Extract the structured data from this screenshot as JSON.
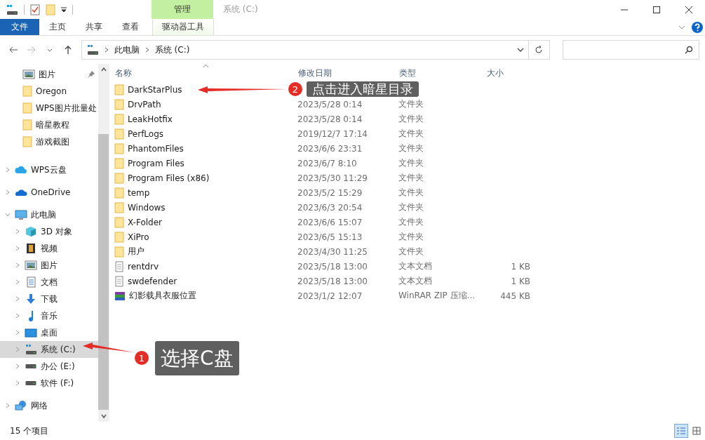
{
  "window": {
    "title": "系统 (C:)",
    "context_tab": "管理"
  },
  "ribbon_tabs": [
    {
      "label": "文件",
      "kind": "file",
      "selected": false
    },
    {
      "label": "主页",
      "kind": "tab",
      "selected": false
    },
    {
      "label": "共享",
      "kind": "tab",
      "selected": false
    },
    {
      "label": "查看",
      "kind": "tab",
      "selected": false
    },
    {
      "label": "驱动器工具",
      "kind": "context",
      "selected": false
    }
  ],
  "address": {
    "breadcrumb": [
      "此电脑",
      "系统 (C:)"
    ]
  },
  "quick_access": [
    {
      "label": "图片",
      "kind": "pictures",
      "pinned": true
    },
    {
      "label": "Oregon",
      "kind": "folder",
      "pinned": false
    },
    {
      "label": "WPS图片批量处",
      "kind": "folder",
      "pinned": false
    },
    {
      "label": "暗星教程",
      "kind": "folder",
      "pinned": false
    },
    {
      "label": "游戏截图",
      "kind": "folder",
      "pinned": false
    }
  ],
  "nav_tree": [
    {
      "label": "WPS云盘",
      "kind": "cloud",
      "expanded": false,
      "selected": false
    },
    {
      "label": "OneDrive",
      "kind": "onedrive",
      "expanded": false,
      "selected": false
    },
    {
      "label": "此电脑",
      "kind": "pc",
      "expanded": true,
      "selected": false,
      "children": [
        {
          "label": "3D 对象",
          "kind": "cube",
          "expanded": false,
          "selected": false
        },
        {
          "label": "视频",
          "kind": "video",
          "expanded": false,
          "selected": false
        },
        {
          "label": "图片",
          "kind": "pictures",
          "expanded": false,
          "selected": false
        },
        {
          "label": "文档",
          "kind": "document",
          "expanded": false,
          "selected": false
        },
        {
          "label": "下载",
          "kind": "download",
          "expanded": false,
          "selected": false
        },
        {
          "label": "音乐",
          "kind": "music",
          "expanded": false,
          "selected": false
        },
        {
          "label": "桌面",
          "kind": "desktop",
          "expanded": false,
          "selected": false
        },
        {
          "label": "系统 (C:)",
          "kind": "system-drive",
          "expanded": false,
          "selected": true
        },
        {
          "label": "办公 (E:)",
          "kind": "drive",
          "expanded": false,
          "selected": false
        },
        {
          "label": "软件 (F:)",
          "kind": "drive",
          "expanded": false,
          "selected": false
        }
      ]
    },
    {
      "label": "网络",
      "kind": "network",
      "expanded": false,
      "selected": false
    }
  ],
  "columns": [
    "名称",
    "修改日期",
    "类型",
    "大小"
  ],
  "files": [
    {
      "name": "DarkStarPlus",
      "kind": "folder"
    },
    {
      "name": "DrvPath",
      "kind": "folder",
      "date": "2023/5/28 0:14",
      "type": "文件夹"
    },
    {
      "name": "LeakHotfix",
      "kind": "folder",
      "date": "2023/5/28 0:14",
      "type": "文件夹"
    },
    {
      "name": "PerfLogs",
      "kind": "folder",
      "date": "2019/12/7 17:14",
      "type": "文件夹"
    },
    {
      "name": "PhantomFiles",
      "kind": "folder",
      "date": "2023/6/6 23:31",
      "type": "文件夹"
    },
    {
      "name": "Program Files",
      "kind": "folder",
      "date": "2023/6/7 8:10",
      "type": "文件夹"
    },
    {
      "name": "Program Files (x86)",
      "kind": "folder",
      "date": "2023/5/30 11:29",
      "type": "文件夹"
    },
    {
      "name": "temp",
      "kind": "folder",
      "date": "2023/5/2 15:29",
      "type": "文件夹"
    },
    {
      "name": "Windows",
      "kind": "folder",
      "date": "2023/6/3 20:54",
      "type": "文件夹"
    },
    {
      "name": "X-Folder",
      "kind": "folder",
      "date": "2023/6/6 15:07",
      "type": "文件夹"
    },
    {
      "name": "XiPro",
      "kind": "folder",
      "date": "2023/6/5 15:13",
      "type": "文件夹"
    },
    {
      "name": "用户",
      "kind": "folder",
      "date": "2023/4/30 11:25",
      "type": "文件夹"
    },
    {
      "name": "rentdrv",
      "kind": "text",
      "date": "2023/5/18 13:00",
      "type": "文本文档",
      "size": "1 KB"
    },
    {
      "name": "swdefender",
      "kind": "text",
      "date": "2023/5/18 13:00",
      "type": "文本文档",
      "size": "1 KB"
    },
    {
      "name": "幻影载具衣服位置",
      "kind": "archive",
      "date": "2023/1/2 12:07",
      "type": "WinRAR ZIP 压缩...",
      "size": "445 KB"
    }
  ],
  "status_bar": {
    "count": "15 个项目",
    "views": [
      {
        "kind": "details",
        "selected": true
      },
      {
        "kind": "large-icons",
        "selected": false
      }
    ]
  },
  "callouts": [
    {
      "number": "1",
      "text": "选择C盘"
    },
    {
      "number": "2",
      "text": "点击进入暗星目录"
    }
  ]
}
